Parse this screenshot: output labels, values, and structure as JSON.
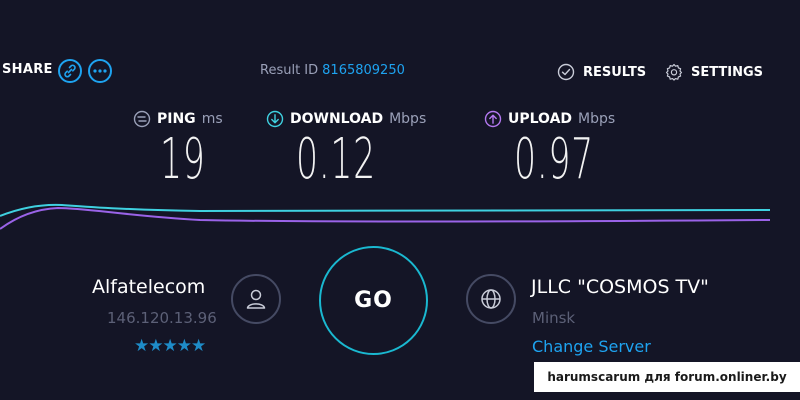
{
  "header": {
    "share_label": "SHARE",
    "result_label": "Result ID",
    "result_id": "8165809250",
    "results_label": "RESULTS",
    "settings_label": "SETTINGS"
  },
  "metrics": {
    "ping": {
      "label": "PING",
      "unit": "ms",
      "value": "19"
    },
    "download": {
      "label": "DOWNLOAD",
      "unit": "Mbps",
      "value": "0.12"
    },
    "upload": {
      "label": "UPLOAD",
      "unit": "Mbps",
      "value": "0.97"
    }
  },
  "graph": {
    "download_color": "#3fd1e0",
    "upload_color": "#9a63e8"
  },
  "provider": {
    "name": "Alfatelecom",
    "ip": "146.120.13.96",
    "rating_stars": "★★★★★",
    "rating": 5
  },
  "go_label": "GO",
  "server": {
    "name": "JLLC \"COSMOS TV\"",
    "city": "Minsk",
    "change_label": "Change Server"
  },
  "watermark": "harumscarum для forum.onliner.by",
  "colors": {
    "accent": "#1ea3f0",
    "background": "#141526",
    "go_ring": "#1ab8d0"
  },
  "icons": [
    "link-icon",
    "more-icon",
    "check-circle-icon",
    "gear-icon",
    "ping-icon",
    "download-arrow-icon",
    "upload-arrow-icon",
    "user-icon",
    "globe-icon"
  ]
}
